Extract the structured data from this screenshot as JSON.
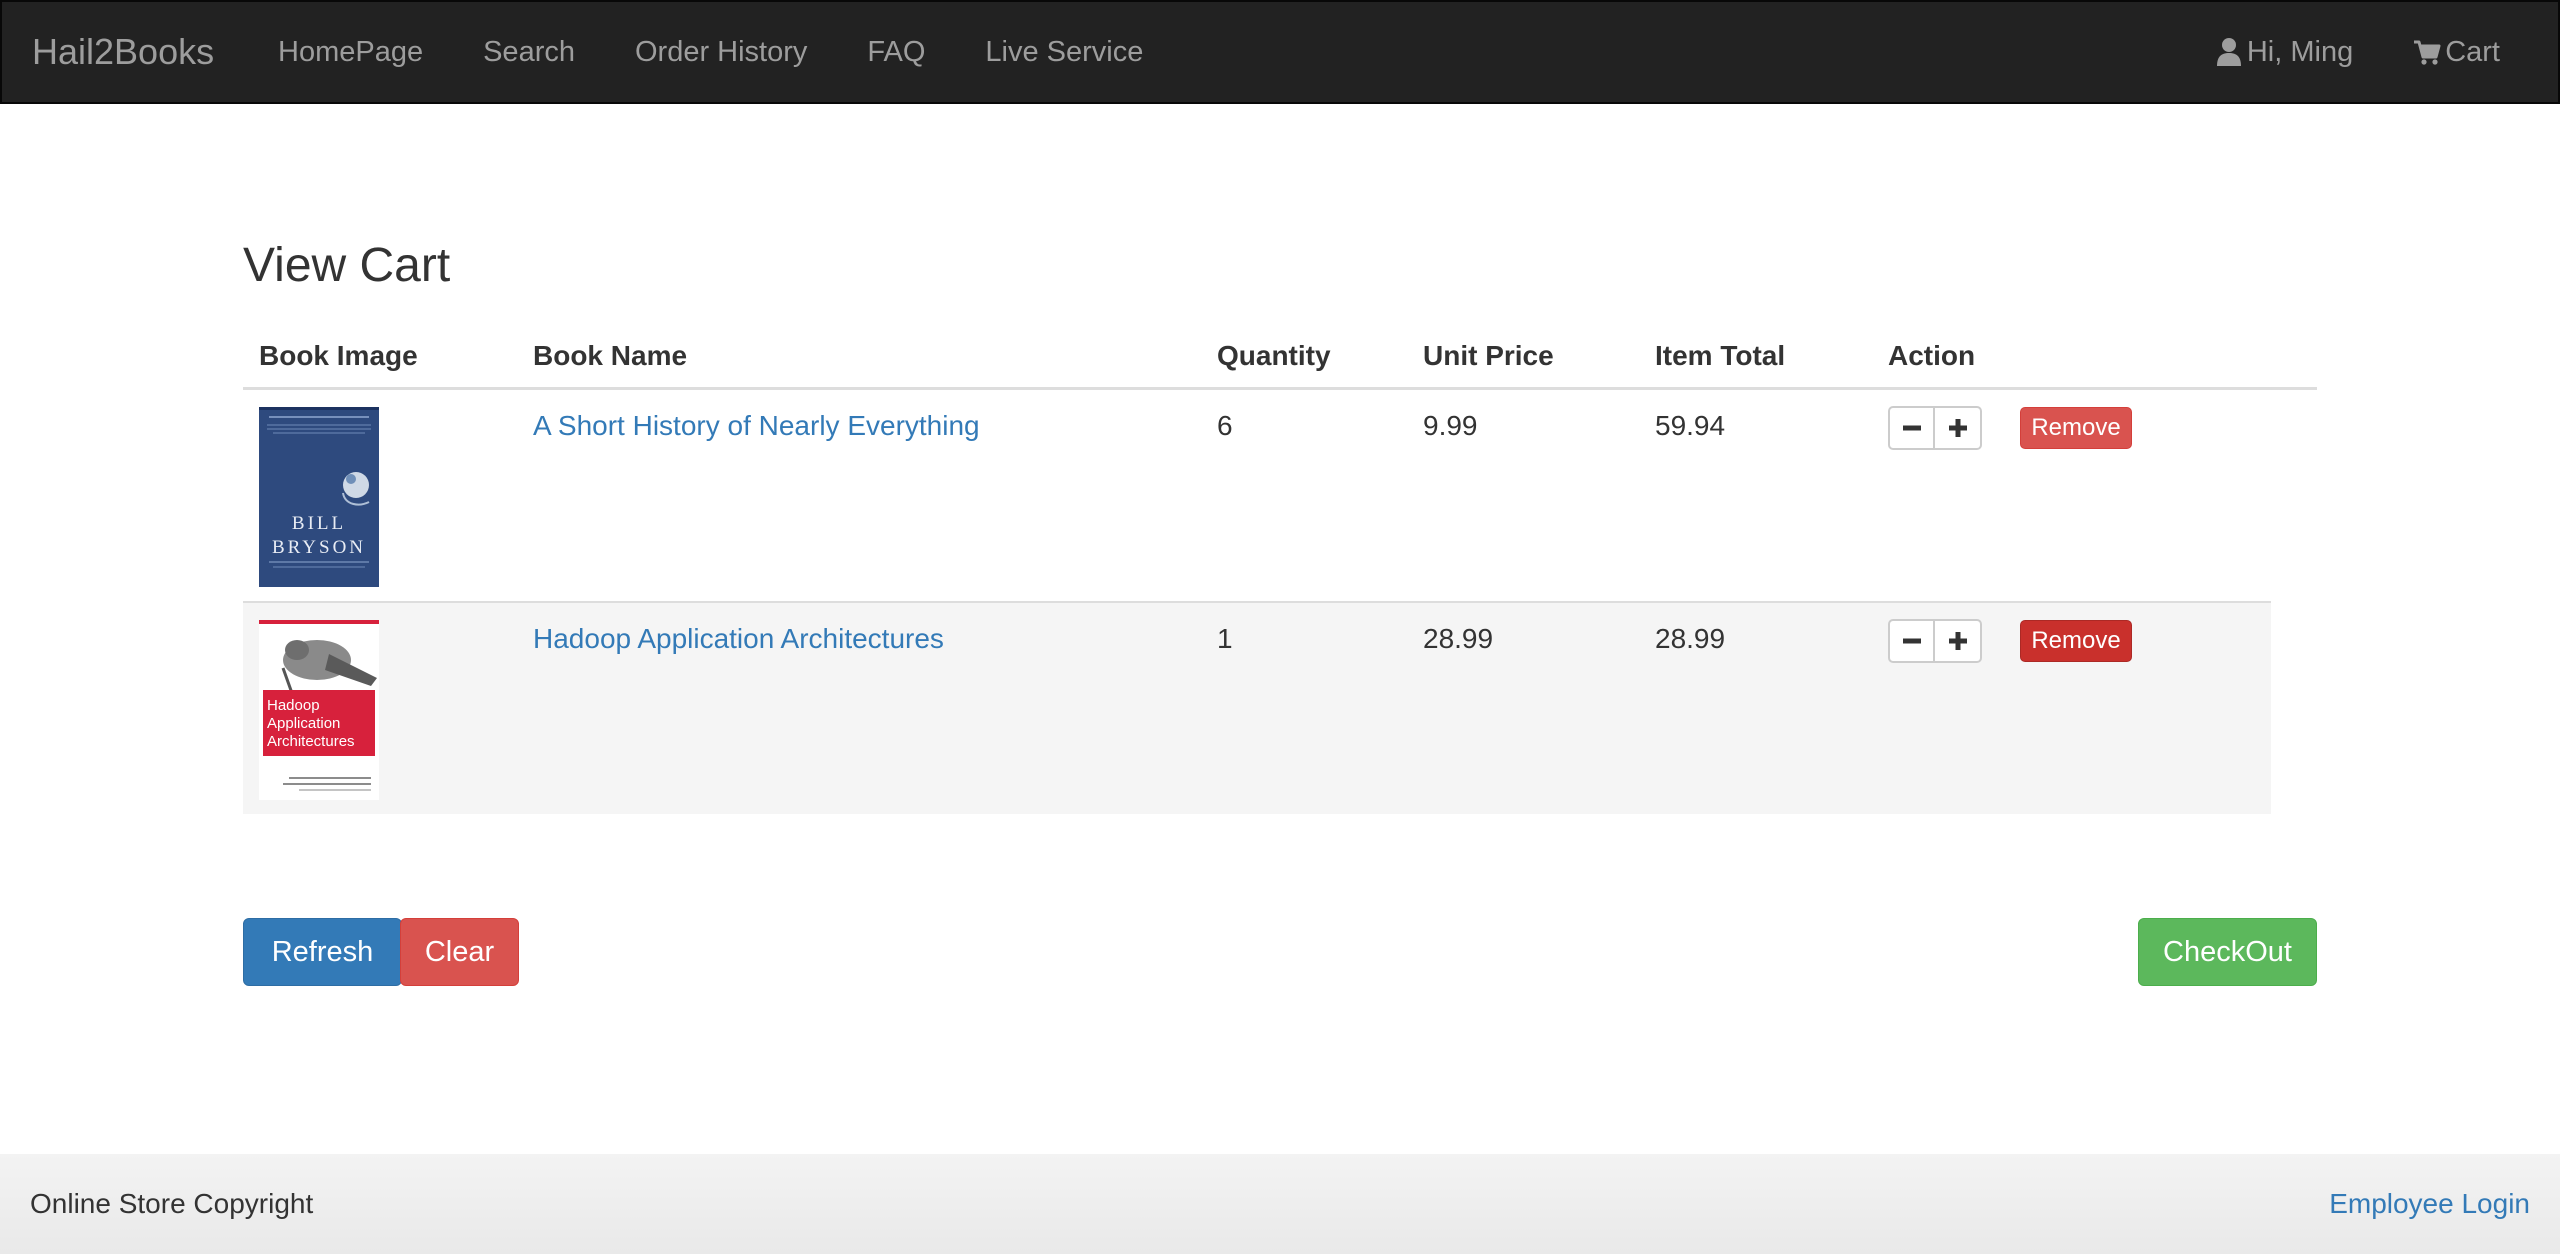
{
  "navbar": {
    "brand": "Hail2Books",
    "links": [
      "HomePage",
      "Search",
      "Order History",
      "FAQ",
      "Live Service"
    ],
    "user": {
      "icon": "user-icon",
      "label": "Hi, Ming"
    },
    "cart": {
      "icon": "shopping-cart-icon",
      "label": "Cart"
    }
  },
  "page": {
    "title": "View Cart"
  },
  "table": {
    "headers": [
      "Book Image",
      "Book Name",
      "Quantity",
      "Unit Price",
      "Item Total",
      "Action"
    ],
    "rows": [
      {
        "cover": {
          "text": [
            "BILL",
            "BRYSON"
          ],
          "bg": "#2e4a7e"
        },
        "name": "A Short History of Nearly Everything",
        "quantity": "6",
        "unit_price": "9.99",
        "item_total": "59.94",
        "remove_label": "Remove"
      },
      {
        "cover": {
          "text": [
            "Hadoop",
            "Application",
            "Architectures"
          ],
          "bg": "#d7213c"
        },
        "name": "Hadoop Application Architectures",
        "quantity": "1",
        "unit_price": "28.99",
        "item_total": "28.99",
        "remove_label": "Remove"
      }
    ],
    "action_icons": {
      "decrease": "minus-icon",
      "increase": "plus-icon"
    }
  },
  "actions": {
    "refresh": "Refresh",
    "clear": "Clear",
    "checkout": "CheckOut"
  },
  "footer": {
    "copyright": "Online Store Copyright",
    "employee_login": "Employee Login"
  },
  "colors": {
    "navbar_bg": "#222222",
    "link": "#337ab7",
    "danger": "#d9534f",
    "primary": "#337ab7",
    "success": "#5cb85c"
  }
}
